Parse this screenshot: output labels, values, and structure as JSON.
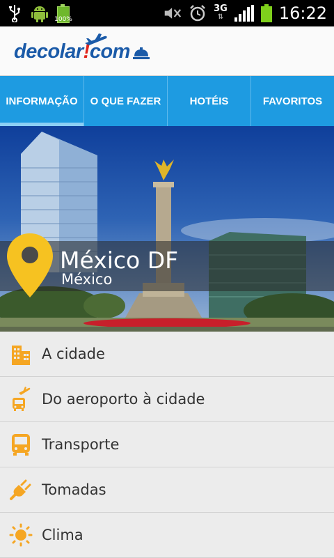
{
  "status_bar": {
    "battery_percent_label": "100%",
    "network": "3G",
    "time": "16:22",
    "icons": [
      "usb-icon",
      "android-icon",
      "battery-icon",
      "mute-icon",
      "alarm-icon",
      "3g-icon",
      "signal-icon",
      "battery-icon"
    ]
  },
  "header": {
    "logo_part1": "decolar",
    "logo_part2": "com"
  },
  "tabs": [
    {
      "label": "INFORMAÇÃO",
      "active": true
    },
    {
      "label": "O QUE FAZER",
      "active": false
    },
    {
      "label": "HOTÉIS",
      "active": false
    },
    {
      "label": "FAVORITOS",
      "active": false
    }
  ],
  "hero": {
    "title": "México DF",
    "subtitle": "México",
    "pin_color": "#f6c221"
  },
  "menu": [
    {
      "label": "A cidade",
      "icon": "buildings-icon"
    },
    {
      "label": "Do aeroporto à cidade",
      "icon": "airport-bus-icon"
    },
    {
      "label": "Transporte",
      "icon": "bus-icon"
    },
    {
      "label": "Tomadas",
      "icon": "plug-icon"
    },
    {
      "label": "Clima",
      "icon": "sun-icon"
    }
  ],
  "colors": {
    "tab_bar": "#1e9be1",
    "tab_indicator": "#8ccff4",
    "icon_orange": "#f5a623",
    "brand_blue": "#1a5aa8",
    "brand_red": "#e1251b"
  }
}
